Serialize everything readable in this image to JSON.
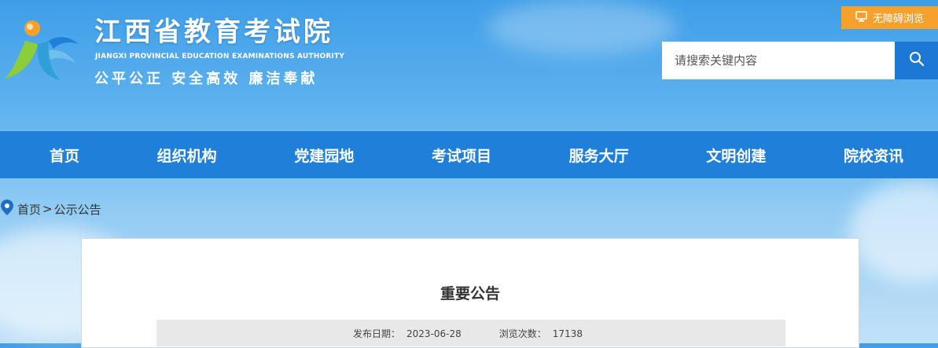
{
  "site": {
    "title": "江西省教育考试院",
    "title_en": "JIANGXI PROVINCIAL EDUCATION EXAMINATIONS AUTHORITY",
    "slogan": "公平公正  安全高效  廉洁奉献"
  },
  "accessibility": {
    "label": "无障碍浏览",
    "icon": "monitor-icon"
  },
  "search": {
    "placeholder": "请搜索关键内容",
    "icon": "search-icon"
  },
  "nav": {
    "items": [
      {
        "label": "首页"
      },
      {
        "label": "组织机构"
      },
      {
        "label": "党建园地"
      },
      {
        "label": "考试项目"
      },
      {
        "label": "服务大厅"
      },
      {
        "label": "文明创建"
      },
      {
        "label": "院校资讯"
      }
    ]
  },
  "breadcrumb": {
    "icon": "location-pin-icon",
    "home": "首页",
    "separator": ">",
    "current": "公示公告"
  },
  "article": {
    "title": "重要公告",
    "publish_label": "发布日期：",
    "publish_date": "2023-06-28",
    "views_label": "浏览次数：",
    "views": "17138"
  },
  "colors": {
    "nav": "#1f7fd9",
    "accent": "#f5a12c",
    "search_button": "#1c78d4"
  }
}
